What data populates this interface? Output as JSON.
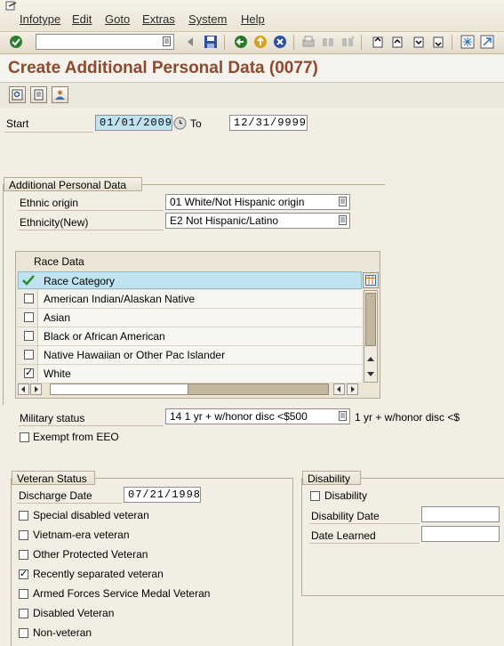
{
  "menu": {
    "items": [
      "Infotype",
      "Edit",
      "Goto",
      "Extras",
      "System",
      "Help"
    ]
  },
  "toolbar": {
    "command_value": ""
  },
  "screen": {
    "title": "Create Additional Personal Data (0077)"
  },
  "validity": {
    "start_label": "Start",
    "start_value": "01/01/2009",
    "to_label": "To",
    "to_value": "12/31/9999"
  },
  "personal": {
    "group_title": "Additional Personal Data",
    "ethnic_origin_label": "Ethnic origin",
    "ethnic_origin_value": "01 White/Not Hispanic origin",
    "ethnicity_new_label": "Ethnicity(New)",
    "ethnicity_new_value": "E2 Not Hispanic/Latino"
  },
  "race": {
    "group_title": "Race Data",
    "column_header": "Race Category",
    "rows": [
      {
        "label": "American Indian/Alaskan Native",
        "checked": false
      },
      {
        "label": "Asian",
        "checked": false
      },
      {
        "label": "Black or African American",
        "checked": false
      },
      {
        "label": "Native Hawaiian or Other Pac Islander",
        "checked": false
      },
      {
        "label": "White",
        "checked": true
      }
    ]
  },
  "military": {
    "label": "Military status",
    "value": "14 1 yr + w/honor disc <$500",
    "description": "1 yr + w/honor disc <$",
    "exempt_label": "Exempt from EEO",
    "exempt_checked": false
  },
  "veteran": {
    "group_title": "Veteran Status",
    "discharge_label": "Discharge Date",
    "discharge_value": "07/21/1998",
    "options": [
      {
        "label": "Special disabled veteran",
        "checked": false
      },
      {
        "label": "Vietnam-era veteran",
        "checked": false
      },
      {
        "label": "Other Protected Veteran",
        "checked": false
      },
      {
        "label": "Recently separated veteran",
        "checked": true
      },
      {
        "label": "Armed Forces Service Medal Veteran",
        "checked": false
      },
      {
        "label": "Disabled Veteran",
        "checked": false
      },
      {
        "label": "Non-veteran",
        "checked": false
      }
    ]
  },
  "disability": {
    "group_title": "Disability",
    "checkbox_label": "Disability",
    "checked": false,
    "date_label": "Disability Date",
    "date_value": "",
    "learned_label": "Date Learned",
    "learned_value": ""
  },
  "colors": {
    "title": "#8c4a2f",
    "highlight": "#bfe3f0",
    "ok_green": "#2e8b2e"
  }
}
